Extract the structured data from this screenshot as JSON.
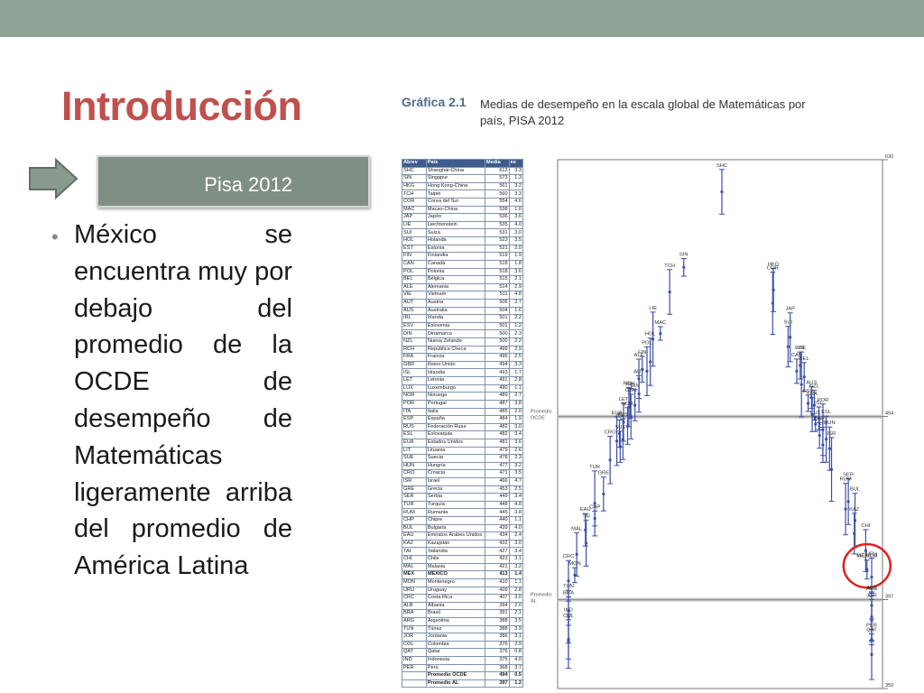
{
  "slide": {
    "title": "Introducción",
    "pisa_label": "Pisa 2012",
    "bullet": "México se encuentra muy por debajo del promedio de la OCDE de desempeño de Matemáticas ligeramente arriba del promedio de América Latina"
  },
  "colors": {
    "title": "#c0504d",
    "topbar": "#8fa497",
    "box": "#7f8f84",
    "series": "#3b4fa8",
    "highlight_circle": "#e02020"
  },
  "icons": {
    "arrow": "right-arrow-icon"
  },
  "figure": {
    "caption_num": "Gráfica 2.1",
    "caption_text": "Medias de desempeño en la escala global de Matemáticas por país, PISA 2012"
  },
  "table": {
    "headers": [
      "Abrev",
      "País",
      "Media",
      "ee"
    ],
    "rows": [
      [
        "SHC",
        "Shanghái-China",
        "613",
        "3.3"
      ],
      [
        "SIN",
        "Singapur",
        "573",
        "1.3"
      ],
      [
        "HKG",
        "Hong Kong-China",
        "561",
        "3.2"
      ],
      [
        "TCH",
        "Taipéi",
        "560",
        "3.3"
      ],
      [
        "COR",
        "Corea del Sur",
        "554",
        "4.6"
      ],
      [
        "MAC",
        "Macao-China",
        "538",
        "1.0"
      ],
      [
        "JAP",
        "Japón",
        "536",
        "3.6"
      ],
      [
        "LIE",
        "Liechtenstein",
        "535",
        "4.0"
      ],
      [
        "SUI",
        "Suiza",
        "531",
        "3.0"
      ],
      [
        "HOL",
        "Holanda",
        "523",
        "3.5"
      ],
      [
        "EST",
        "Estonia",
        "521",
        "2.0"
      ],
      [
        "FIN",
        "Finlandia",
        "519",
        "1.9"
      ],
      [
        "CAN",
        "Canadá",
        "518",
        "1.8"
      ],
      [
        "POL",
        "Polonia",
        "518",
        "3.6"
      ],
      [
        "BEL",
        "Bélgica",
        "515",
        "2.1"
      ],
      [
        "ALE",
        "Alemania",
        "514",
        "2.9"
      ],
      [
        "VIE",
        "Vietnam",
        "511",
        "4.8"
      ],
      [
        "AUT",
        "Austria",
        "506",
        "2.7"
      ],
      [
        "AUS",
        "Australia",
        "504",
        "1.6"
      ],
      [
        "IRL",
        "Irlanda",
        "501",
        "2.2"
      ],
      [
        "ESV",
        "Eslovenia",
        "501",
        "1.2"
      ],
      [
        "DIN",
        "Dinamarca",
        "500",
        "2.3"
      ],
      [
        "NZL",
        "Nueva Zelanda",
        "500",
        "2.2"
      ],
      [
        "RCH",
        "República Checa",
        "499",
        "2.9"
      ],
      [
        "FRA",
        "Francia",
        "495",
        "2.5"
      ],
      [
        "GBR",
        "Reino Unido",
        "494",
        "3.3"
      ],
      [
        "ISL",
        "Islandia",
        "493",
        "1.7"
      ],
      [
        "LET",
        "Letonia",
        "491",
        "2.8"
      ],
      [
        "LUX",
        "Luxemburgo",
        "490",
        "1.1"
      ],
      [
        "NOR",
        "Noruega",
        "489",
        "2.7"
      ],
      [
        "POR",
        "Portugal",
        "487",
        "3.8"
      ],
      [
        "ITA",
        "Italia",
        "485",
        "2.0"
      ],
      [
        "ESP",
        "España",
        "484",
        "1.9"
      ],
      [
        "RUS",
        "Federación Rusa",
        "482",
        "3.0"
      ],
      [
        "ESL",
        "Eslovaquia",
        "482",
        "3.4"
      ],
      [
        "EUA",
        "Estados Unidos",
        "481",
        "3.6"
      ],
      [
        "LIT",
        "Lituania",
        "479",
        "2.6"
      ],
      [
        "SUE",
        "Suecia",
        "478",
        "2.3"
      ],
      [
        "HUN",
        "Hungría",
        "477",
        "3.2"
      ],
      [
        "CRO",
        "Croacia",
        "471",
        "3.5"
      ],
      [
        "ISR",
        "Israel",
        "466",
        "4.7"
      ],
      [
        "GRE",
        "Grecia",
        "453",
        "2.5"
      ],
      [
        "SER",
        "Serbia",
        "449",
        "3.4"
      ],
      [
        "TUR",
        "Turquía",
        "448",
        "4.8"
      ],
      [
        "RUM",
        "Rumania",
        "445",
        "3.8"
      ],
      [
        "CHP",
        "Chipre",
        "440",
        "1.1"
      ],
      [
        "BUL",
        "Bulgaria",
        "439",
        "4.0"
      ],
      [
        "EAU",
        "Emiratos Árabes Unidos",
        "434",
        "2.4"
      ],
      [
        "KAZ",
        "Kazajstán",
        "432",
        "3.0"
      ],
      [
        "TAI",
        "Tailandia",
        "427",
        "3.4"
      ],
      [
        "CHI",
        "Chile",
        "423",
        "3.1"
      ],
      [
        "MAL",
        "Malasia",
        "421",
        "3.2"
      ],
      [
        "MEX",
        "MÉXICO",
        "413",
        "1.4"
      ],
      [
        "MON",
        "Montenegro",
        "410",
        "1.1"
      ],
      [
        "URU",
        "Uruguay",
        "409",
        "2.8"
      ],
      [
        "CRC",
        "Costa Rica",
        "407",
        "3.0"
      ],
      [
        "ALB",
        "Albania",
        "394",
        "2.0"
      ],
      [
        "BRA",
        "Brasil",
        "391",
        "2.1"
      ],
      [
        "ARG",
        "Argentina",
        "388",
        "3.5"
      ],
      [
        "TUN",
        "Túnez",
        "388",
        "3.9"
      ],
      [
        "JOR",
        "Jordania",
        "386",
        "3.1"
      ],
      [
        "COL",
        "Colombia",
        "376",
        "2.9"
      ],
      [
        "QAT",
        "Qatar",
        "376",
        "0.8"
      ],
      [
        "IND",
        "Indonesia",
        "375",
        "4.0"
      ],
      [
        "PER",
        "Perú",
        "368",
        "3.7"
      ]
    ],
    "footer": [
      [
        "",
        "Promedio OCDE",
        "494",
        "0.5"
      ],
      [
        "",
        "Promedio AL",
        "397",
        "1.2"
      ]
    ]
  },
  "chart_data": {
    "type": "scatter",
    "title": "",
    "ylim": [
      350,
      630
    ],
    "y_ticks": [
      630,
      494,
      397,
      350
    ],
    "reference_lines": [
      {
        "label": "Promedio OCDE",
        "value": 494
      },
      {
        "label": "Promedio AL",
        "value": 397
      }
    ],
    "highlighted": "MÉXICO",
    "series": [
      {
        "points": [
          {
            "label": "SHC",
            "mean": 613
          },
          {
            "label": "SIN",
            "mean": 573
          },
          {
            "label": "HKG",
            "mean": 561
          },
          {
            "label": "TCH",
            "mean": 560
          },
          {
            "label": "COR",
            "mean": 554
          },
          {
            "label": "MAC",
            "mean": 538
          },
          {
            "label": "JAP",
            "mean": 536
          },
          {
            "label": "LIE",
            "mean": 535
          },
          {
            "label": "SUI",
            "mean": 531
          },
          {
            "label": "HOL",
            "mean": 523
          },
          {
            "label": "EST",
            "mean": 521
          },
          {
            "label": "FIN",
            "mean": 519
          },
          {
            "label": "CAN",
            "mean": 518
          },
          {
            "label": "POL",
            "mean": 518
          },
          {
            "label": "BEL",
            "mean": 515
          },
          {
            "label": "ALE",
            "mean": 514
          },
          {
            "label": "VIE",
            "mean": 511
          },
          {
            "label": "AUT",
            "mean": 506
          },
          {
            "label": "AUS",
            "mean": 504
          },
          {
            "label": "IRL",
            "mean": 501
          },
          {
            "label": "ESV",
            "mean": 501
          },
          {
            "label": "DIN",
            "mean": 500
          },
          {
            "label": "NZL",
            "mean": 500
          },
          {
            "label": "RCH",
            "mean": 499
          },
          {
            "label": "FRA",
            "mean": 495
          },
          {
            "label": "GBR",
            "mean": 494
          },
          {
            "label": "ISL",
            "mean": 493
          },
          {
            "label": "LET",
            "mean": 491
          },
          {
            "label": "LUX",
            "mean": 490
          },
          {
            "label": "NOR",
            "mean": 489
          },
          {
            "label": "POR",
            "mean": 487
          },
          {
            "label": "ITA",
            "mean": 485
          },
          {
            "label": "ESP",
            "mean": 484
          },
          {
            "label": "RUS",
            "mean": 482
          },
          {
            "label": "ESL",
            "mean": 482
          },
          {
            "label": "EUA",
            "mean": 481
          },
          {
            "label": "LIT",
            "mean": 479
          },
          {
            "label": "SUE",
            "mean": 478
          },
          {
            "label": "HUN",
            "mean": 477
          },
          {
            "label": "CRO",
            "mean": 471
          },
          {
            "label": "ISR",
            "mean": 466
          },
          {
            "label": "GRE",
            "mean": 453
          },
          {
            "label": "SER",
            "mean": 449
          },
          {
            "label": "TUR",
            "mean": 448
          },
          {
            "label": "RUM",
            "mean": 445
          },
          {
            "label": "CHP",
            "mean": 440
          },
          {
            "label": "BUL",
            "mean": 439
          },
          {
            "label": "EAU",
            "mean": 434
          },
          {
            "label": "KAZ",
            "mean": 432
          },
          {
            "label": "TAI",
            "mean": 427
          },
          {
            "label": "CHI",
            "mean": 423
          },
          {
            "label": "MAL",
            "mean": 421
          },
          {
            "label": "MÉXICO",
            "mean": 413
          },
          {
            "label": "MON",
            "mean": 410
          },
          {
            "label": "URU",
            "mean": 409
          },
          {
            "label": "CRC",
            "mean": 407
          },
          {
            "label": "ALB",
            "mean": 394
          },
          {
            "label": "BRA",
            "mean": 391
          },
          {
            "label": "ARG",
            "mean": 388
          },
          {
            "label": "TUN",
            "mean": 388
          },
          {
            "label": "JOR",
            "mean": 386
          },
          {
            "label": "COL",
            "mean": 376
          },
          {
            "label": "QAT",
            "mean": 376
          },
          {
            "label": "IND",
            "mean": 375
          },
          {
            "label": "PER",
            "mean": 368
          }
        ]
      }
    ]
  }
}
